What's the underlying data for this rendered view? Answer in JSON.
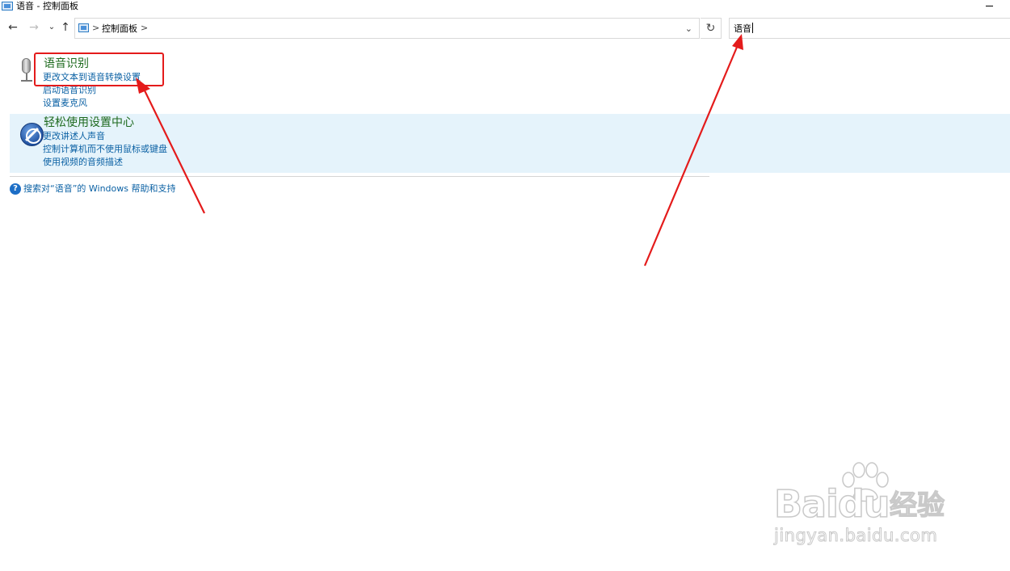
{
  "window": {
    "title": "语音 - 控制面板"
  },
  "navigation": {
    "back_icon": "back-arrow-icon",
    "forward_icon": "forward-arrow-icon",
    "recent_icon": "chevron-down-icon",
    "up_icon": "up-arrow-icon",
    "breadcrumb": [
      "控制面板"
    ],
    "separator": ">",
    "refresh_icon": "refresh-icon"
  },
  "search": {
    "value": "语音"
  },
  "results": [
    {
      "title": "语音识别",
      "icon": "microphone-icon",
      "links": [
        "更改文本到语音转换设置",
        "启动语音识别",
        "设置麦克风"
      ]
    },
    {
      "title": "轻松使用设置中心",
      "icon": "ease-of-access-icon",
      "links": [
        "更改讲述人声音",
        "控制计算机而不使用鼠标或键盘",
        "使用视频的音频描述"
      ]
    }
  ],
  "help": {
    "icon": "help-icon",
    "label": "搜索对“语音”的 Windows 帮助和支持"
  },
  "watermark": {
    "brand": "Baidu",
    "suffix": "经验",
    "url": "jingyan.baidu.com"
  },
  "colors": {
    "annotation_red": "#e41b1b",
    "link_blue": "#0b61a4",
    "title_green": "#1e6a1e",
    "highlight_bg": "#e5f3fb"
  }
}
